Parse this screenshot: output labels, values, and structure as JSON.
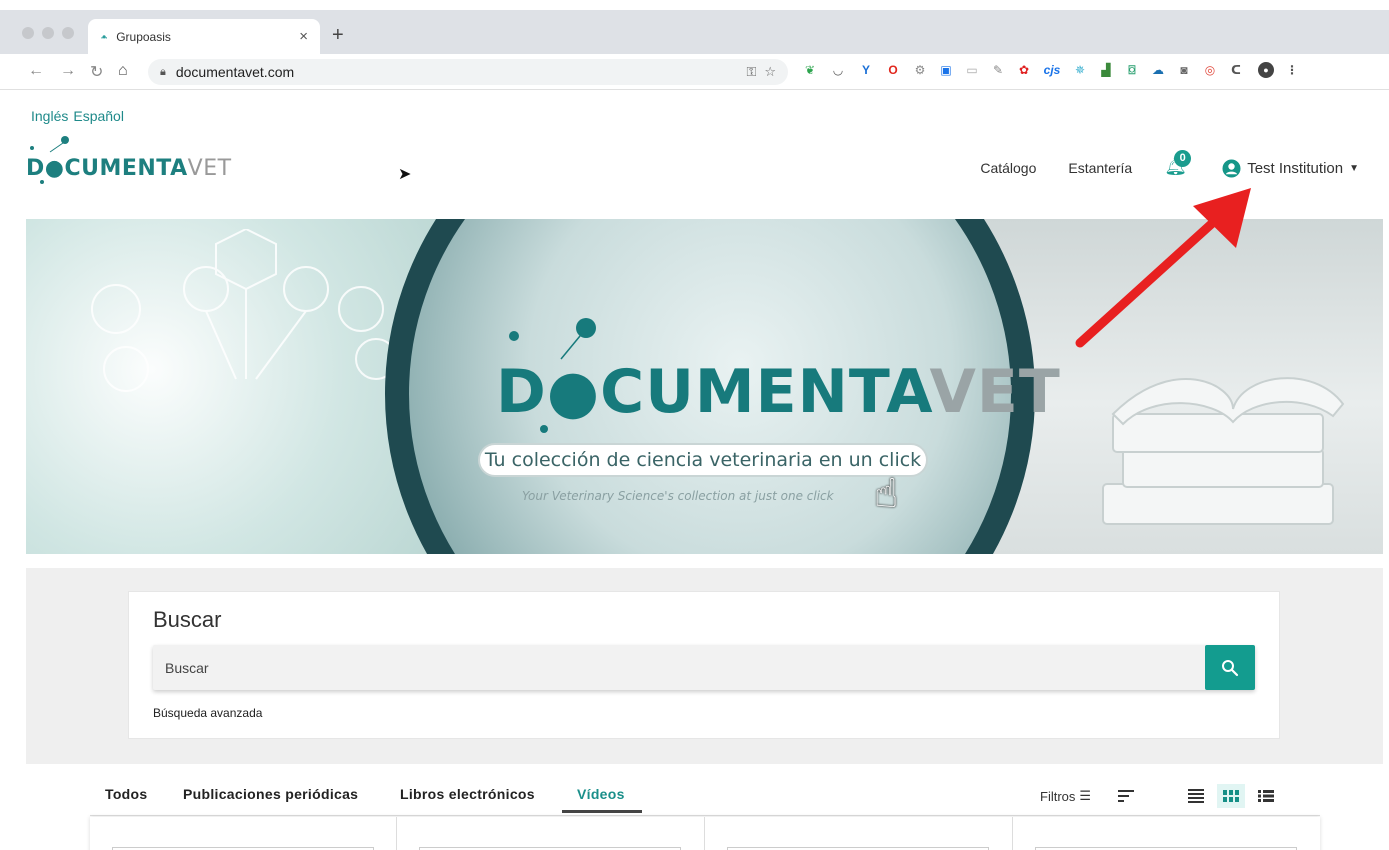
{
  "browser": {
    "tab_title": "Grupoasis",
    "tab_close": "×",
    "new_tab": "+",
    "url": "documentavet.com"
  },
  "header": {
    "languages": [
      "Inglés",
      "Español"
    ],
    "logo_main": "D●CUMENTA",
    "logo_vet": "VET",
    "nav": {
      "catalog": "Catálogo",
      "shelf": "Estantería",
      "notifications_count": "0",
      "user": "Test Institution"
    }
  },
  "banner": {
    "logo_main": "D●CUMENTA",
    "logo_vet": "VET",
    "tagline": "Tu colección de ciencia veterinaria en un click",
    "subtagline": "Your Veterinary Science's collection at just one click"
  },
  "search": {
    "title": "Buscar",
    "placeholder": "Buscar",
    "advanced": "Búsqueda avanzada"
  },
  "tabs": {
    "items": [
      "Todos",
      "Publicaciones periódicas",
      "Libros electrónicos",
      "Vídeos"
    ],
    "active": "Vídeos",
    "filters": "Filtros"
  },
  "colors": {
    "accent": "#139c8f",
    "annotation_arrow": "#e82020"
  }
}
